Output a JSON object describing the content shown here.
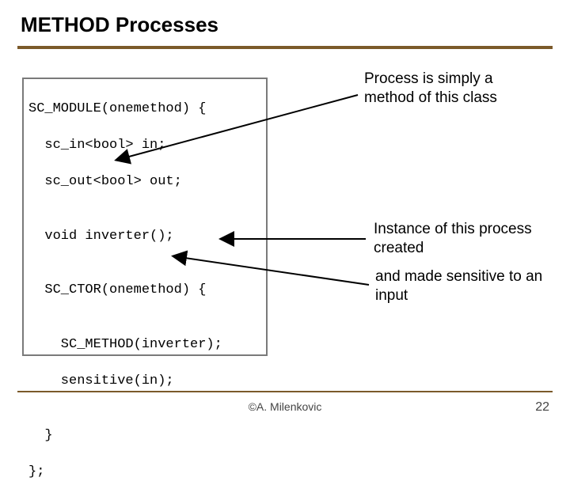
{
  "title": "METHOD Processes",
  "code": {
    "l01": "SC_MODULE(onemethod) {",
    "l02": "  sc_in<bool> in;",
    "l03": "  sc_out<bool> out;",
    "l04": "",
    "l05": "  void inverter();",
    "l06": "",
    "l07": "  SC_CTOR(onemethod) {",
    "l08": "",
    "l09": "    SC_METHOD(inverter);",
    "l10": "    sensitive(in);",
    "l11": "",
    "l12": "  }",
    "l13": "};"
  },
  "annot": {
    "a1": "Process is simply a method of this class",
    "a2": "Instance of this process created",
    "a3": "and made sensitive to an input"
  },
  "footer": {
    "author": "©A. Milenkovic",
    "page": "22"
  }
}
